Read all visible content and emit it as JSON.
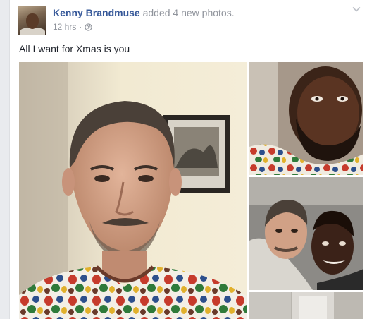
{
  "post": {
    "author": "Kenny Brandmuse",
    "action": " added 4 new photos.",
    "timestamp": "12 hrs",
    "separator": "·",
    "text": "All I want for Xmas is you"
  },
  "icons": {
    "audience": "globe-icon",
    "options": "chevron-down-icon"
  },
  "photos": {
    "count": 4,
    "shown": [
      "main-portrait",
      "selfie-dark",
      "selfie-couple",
      "interior-partial"
    ]
  },
  "colors": {
    "author_link": "#365899",
    "meta_text": "#90949c",
    "body_text": "#1d2129"
  }
}
